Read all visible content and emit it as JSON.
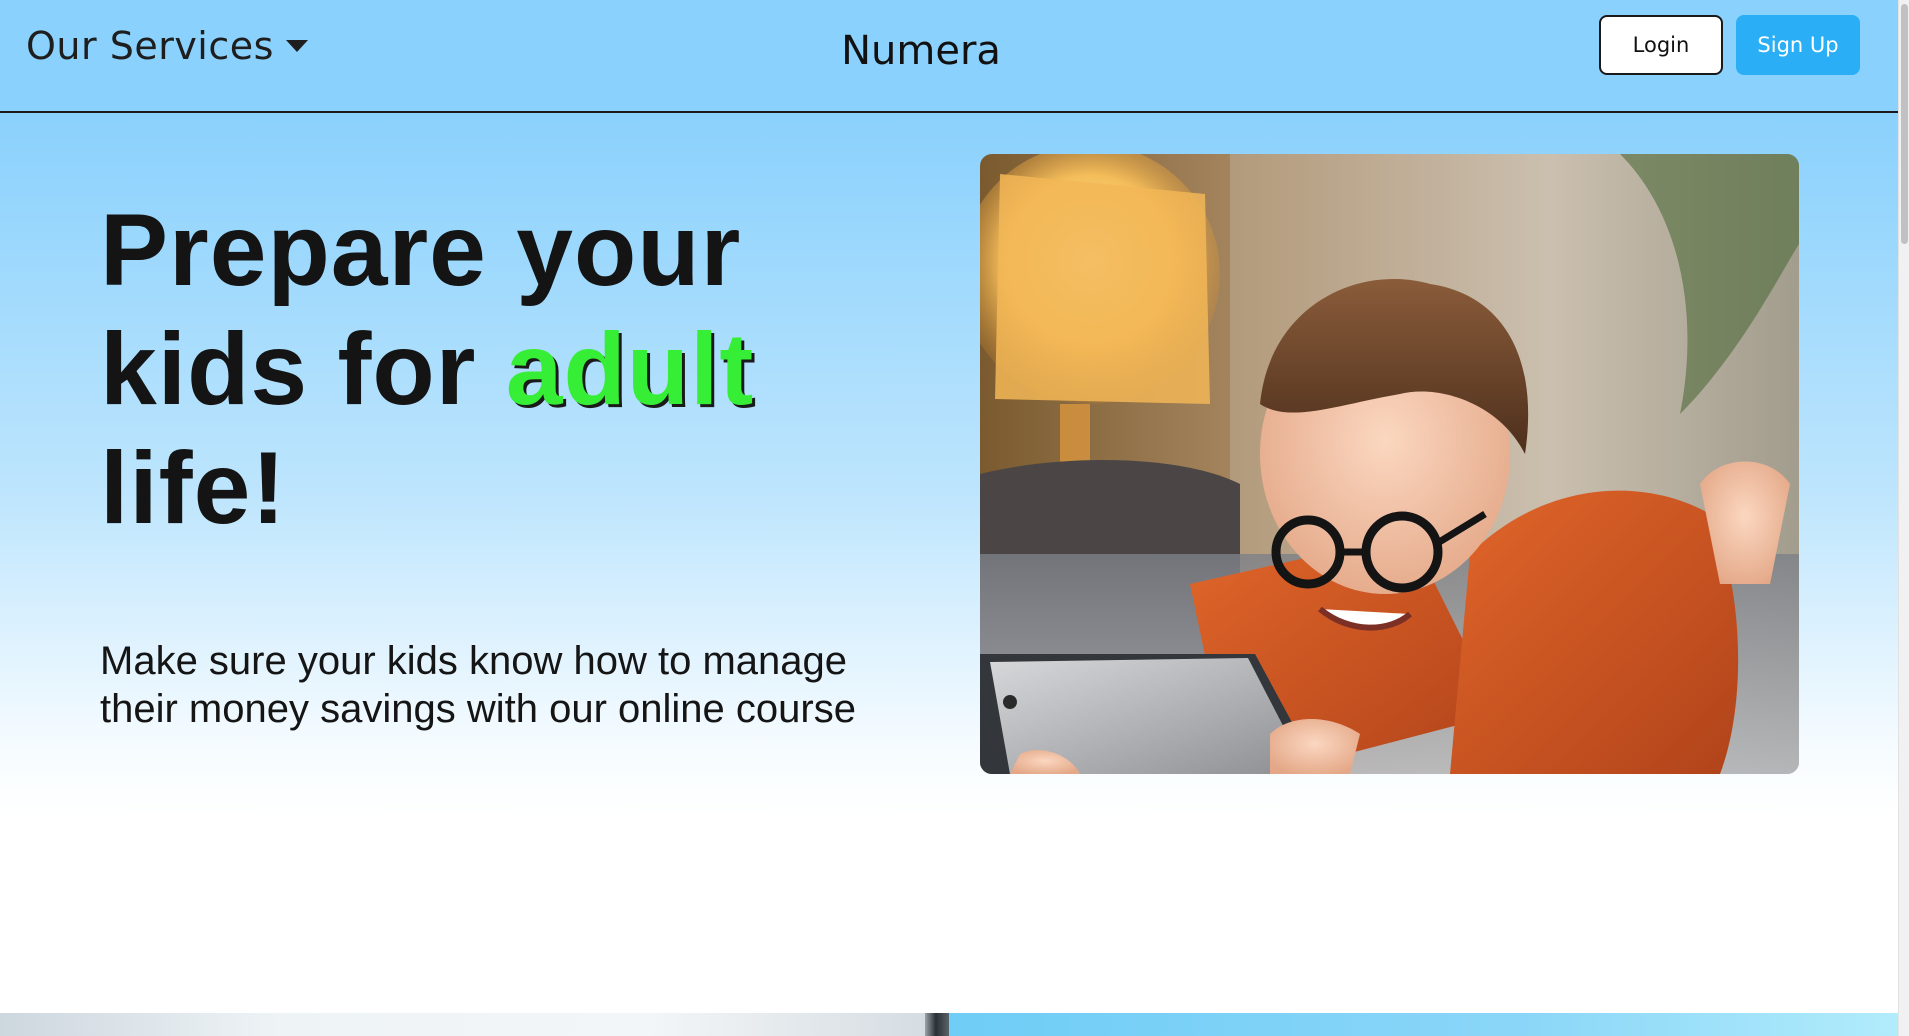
{
  "navbar": {
    "services_label": "Our Services",
    "brand": "Numera",
    "login_label": "Login",
    "signup_label": "Sign Up"
  },
  "hero": {
    "headline_part1": "Prepare your kids for ",
    "headline_accent": "adult",
    "headline_part2": " life!",
    "subtext": "Make sure your kids know how to manage their money savings with our online course",
    "image_icon": "kid-with-tablet-photo"
  },
  "colors": {
    "nav_bg": "#8ad1fd",
    "accent_green": "#36ee36",
    "signup_bg": "#2aaef5",
    "text_dark": "#141414"
  }
}
